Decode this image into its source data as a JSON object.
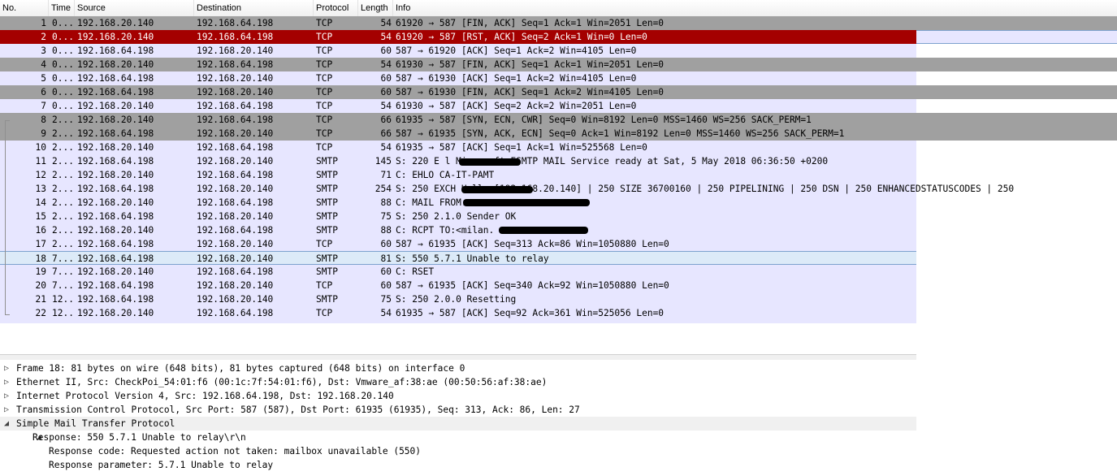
{
  "columns": {
    "no": "No.",
    "time": "Time",
    "source": "Source",
    "destination": "Destination",
    "protocol": "Protocol",
    "length": "Length",
    "info": "Info"
  },
  "colors": {
    "gray_row": "#a0a0a0",
    "selected_red": "#a40000",
    "lavender_row": "#e7e6ff",
    "highlighted_row": "#dceaf8",
    "tree_selected": "#f0f0f0"
  },
  "packets": [
    {
      "no": "1",
      "time": "0...",
      "src": "192.168.20.140",
      "dst": "192.168.64.198",
      "proto": "TCP",
      "len": "54",
      "info": "61920 → 587 [FIN, ACK] Seq=1 Ack=1 Win=2051 Len=0",
      "style": "gray"
    },
    {
      "no": "2",
      "time": "0...",
      "src": "192.168.20.140",
      "dst": "192.168.64.198",
      "proto": "TCP",
      "len": "54",
      "info": "61920 → 587 [RST, ACK] Seq=2 Ack=1 Win=0 Len=0",
      "style": "red"
    },
    {
      "no": "3",
      "time": "0...",
      "src": "192.168.64.198",
      "dst": "192.168.20.140",
      "proto": "TCP",
      "len": "60",
      "info": "587 → 61920 [ACK] Seq=1 Ack=2 Win=4105 Len=0",
      "style": "lavender"
    },
    {
      "no": "4",
      "time": "0...",
      "src": "192.168.20.140",
      "dst": "192.168.64.198",
      "proto": "TCP",
      "len": "54",
      "info": "61930 → 587 [FIN, ACK] Seq=1 Ack=1 Win=2051 Len=0",
      "style": "gray"
    },
    {
      "no": "5",
      "time": "0...",
      "src": "192.168.64.198",
      "dst": "192.168.20.140",
      "proto": "TCP",
      "len": "60",
      "info": "587 → 61930 [ACK] Seq=1 Ack=2 Win=4105 Len=0",
      "style": "lavender"
    },
    {
      "no": "6",
      "time": "0...",
      "src": "192.168.64.198",
      "dst": "192.168.20.140",
      "proto": "TCP",
      "len": "60",
      "info": "587 → 61930 [FIN, ACK] Seq=1 Ack=2 Win=4105 Len=0",
      "style": "gray"
    },
    {
      "no": "7",
      "time": "0...",
      "src": "192.168.20.140",
      "dst": "192.168.64.198",
      "proto": "TCP",
      "len": "54",
      "info": "61930 → 587 [ACK] Seq=2 Ack=2 Win=2051 Len=0",
      "style": "lavender"
    },
    {
      "no": "8",
      "time": "2...",
      "src": "192.168.20.140",
      "dst": "192.168.64.198",
      "proto": "TCP",
      "len": "66",
      "info": "61935 → 587 [SYN, ECN, CWR] Seq=0 Win=8192 Len=0 MSS=1460 WS=256 SACK_PERM=1",
      "style": "gray"
    },
    {
      "no": "9",
      "time": "2...",
      "src": "192.168.64.198",
      "dst": "192.168.20.140",
      "proto": "TCP",
      "len": "66",
      "info": "587 → 61935 [SYN, ACK, ECN] Seq=0 Ack=1 Win=8192 Len=0 MSS=1460 WS=256 SACK_PERM=1",
      "style": "gray"
    },
    {
      "no": "10",
      "time": "2...",
      "src": "192.168.20.140",
      "dst": "192.168.64.198",
      "proto": "TCP",
      "len": "54",
      "info": "61935 → 587 [ACK] Seq=1 Ack=1 Win=525568 Len=0",
      "style": "lavender"
    },
    {
      "no": "11",
      "time": "2...",
      "src": "192.168.64.198",
      "dst": "192.168.20.140",
      "proto": "SMTP",
      "len": "145",
      "info": "S: 220 E                l Microsoft ESMTP MAIL Service ready at Sat, 5 May 2018 06:36:50 +0200",
      "style": "lavender"
    },
    {
      "no": "12",
      "time": "2...",
      "src": "192.168.20.140",
      "dst": "192.168.64.198",
      "proto": "SMTP",
      "len": "71",
      "info": "C: EHLO CA-IT-PAMT",
      "style": "lavender"
    },
    {
      "no": "13",
      "time": "2...",
      "src": "192.168.64.198",
      "dst": "192.168.20.140",
      "proto": "SMTP",
      "len": "254",
      "info": "S: 250 EXCH          Hello [192.168.20.140] | 250 SIZE 36700160 | 250 PIPELINING | 250 DSN | 250 ENHANCEDSTATUSCODES | 250",
      "style": "lavender"
    },
    {
      "no": "14",
      "time": "2...",
      "src": "192.168.20.140",
      "dst": "192.168.64.198",
      "proto": "SMTP",
      "len": "88",
      "info": "C: MAIL FROM:<ca                   z>",
      "style": "lavender"
    },
    {
      "no": "15",
      "time": "2...",
      "src": "192.168.64.198",
      "dst": "192.168.20.140",
      "proto": "SMTP",
      "len": "75",
      "info": "S: 250 2.1.0 Sender OK",
      "style": "lavender"
    },
    {
      "no": "16",
      "time": "2...",
      "src": "192.168.20.140",
      "dst": "192.168.64.198",
      "proto": "SMTP",
      "len": "88",
      "info": "C: RCPT TO:<milan.                 >",
      "style": "lavender"
    },
    {
      "no": "17",
      "time": "2...",
      "src": "192.168.64.198",
      "dst": "192.168.20.140",
      "proto": "TCP",
      "len": "60",
      "info": "587 → 61935 [ACK] Seq=313 Ack=86 Win=1050880 Len=0",
      "style": "lavender"
    },
    {
      "no": "18",
      "time": "7...",
      "src": "192.168.64.198",
      "dst": "192.168.20.140",
      "proto": "SMTP",
      "len": "81",
      "info": "S: 550 5.7.1 Unable to relay",
      "style": "highlighted"
    },
    {
      "no": "19",
      "time": "7...",
      "src": "192.168.20.140",
      "dst": "192.168.64.198",
      "proto": "SMTP",
      "len": "60",
      "info": "C: RSET",
      "style": "lavender"
    },
    {
      "no": "20",
      "time": "7...",
      "src": "192.168.64.198",
      "dst": "192.168.20.140",
      "proto": "TCP",
      "len": "60",
      "info": "587 → 61935 [ACK] Seq=340 Ack=92 Win=1050880 Len=0",
      "style": "lavender"
    },
    {
      "no": "21",
      "time": "12...",
      "src": "192.168.64.198",
      "dst": "192.168.20.140",
      "proto": "SMTP",
      "len": "75",
      "info": "S: 250 2.0.0 Resetting",
      "style": "lavender"
    },
    {
      "no": "22",
      "time": "12...",
      "src": "192.168.20.140",
      "dst": "192.168.64.198",
      "proto": "TCP",
      "len": "54",
      "info": "61935 → 587 [ACK] Seq=92 Ack=361 Win=525056 Len=0",
      "style": "lavender"
    }
  ],
  "details": [
    {
      "text": "Frame 18: 81 bytes on wire (648 bits), 81 bytes captured (648 bits) on interface 0",
      "indent": 0,
      "state": "collapsed"
    },
    {
      "text": "Ethernet II, Src: CheckPoi_54:01:f6 (00:1c:7f:54:01:f6), Dst: Vmware_af:38:ae (00:50:56:af:38:ae)",
      "indent": 0,
      "state": "collapsed"
    },
    {
      "text": "Internet Protocol Version 4, Src: 192.168.64.198, Dst: 192.168.20.140",
      "indent": 0,
      "state": "collapsed"
    },
    {
      "text": "Transmission Control Protocol, Src Port: 587 (587), Dst Port: 61935 (61935), Seq: 313, Ack: 86, Len: 27",
      "indent": 0,
      "state": "collapsed"
    },
    {
      "text": "Simple Mail Transfer Protocol",
      "indent": 0,
      "state": "expanded"
    },
    {
      "text": "Response: 550 5.7.1 Unable to relay\\r\\n",
      "indent": 1,
      "state": "expanded"
    },
    {
      "text": "Response code: Requested action not taken: mailbox unavailable (550)",
      "indent": 2,
      "state": "leaf"
    },
    {
      "text": "Response parameter: 5.7.1 Unable to relay",
      "indent": 2,
      "state": "leaf"
    }
  ]
}
